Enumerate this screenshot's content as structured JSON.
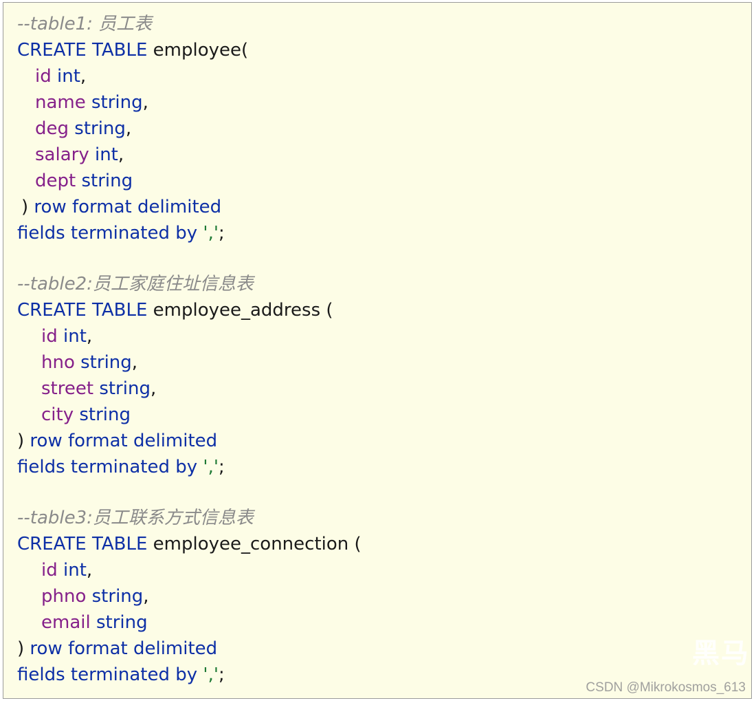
{
  "tables": [
    {
      "comment": "--table1: 员工表",
      "create_kw": "CREATE TABLE",
      "name": "employee(",
      "columns": [
        {
          "field": "id",
          "type": "int",
          "sep": ","
        },
        {
          "field": "name",
          "type": "string",
          "sep": ","
        },
        {
          "field": "deg",
          "type": "string",
          "sep": ","
        },
        {
          "field": "salary",
          "type": "int",
          "sep": ","
        },
        {
          "field": "dept",
          "type": "string",
          "sep": ""
        }
      ],
      "close_paren": ")",
      "row_format": "row format delimited",
      "fields_terminated": "fields terminated by",
      "delimiter": "','",
      "semicolon": ";"
    },
    {
      "comment": "--table2:员工家庭住址信息表",
      "create_kw": "CREATE TABLE",
      "name": "employee_address (",
      "columns": [
        {
          "field": "id",
          "type": "int",
          "sep": ","
        },
        {
          "field": "hno",
          "type": "string",
          "sep": ","
        },
        {
          "field": "street",
          "type": "string",
          "sep": ","
        },
        {
          "field": "city",
          "type": "string",
          "sep": ""
        }
      ],
      "close_paren": ")",
      "row_format": "row format delimited",
      "fields_terminated": "fields terminated by",
      "delimiter": "','",
      "semicolon": ";"
    },
    {
      "comment": "--table3:员工联系方式信息表",
      "create_kw": "CREATE TABLE",
      "name": "employee_connection (",
      "columns": [
        {
          "field": "id",
          "type": "int",
          "sep": ","
        },
        {
          "field": "phno",
          "type": "string",
          "sep": ","
        },
        {
          "field": "email",
          "type": "string",
          "sep": ""
        }
      ],
      "close_paren": ")",
      "row_format": "row format delimited",
      "fields_terminated": "fields terminated by",
      "delimiter": "','",
      "semicolon": ";"
    }
  ],
  "watermark": {
    "logo": "黑马",
    "text": "CSDN @Mikrokosmos_613"
  },
  "colors": {
    "background": "#fdfde6",
    "keyword": "#0d2fa6",
    "field": "#85208a",
    "string": "#1f7a36",
    "comment": "#8a8a8a"
  }
}
